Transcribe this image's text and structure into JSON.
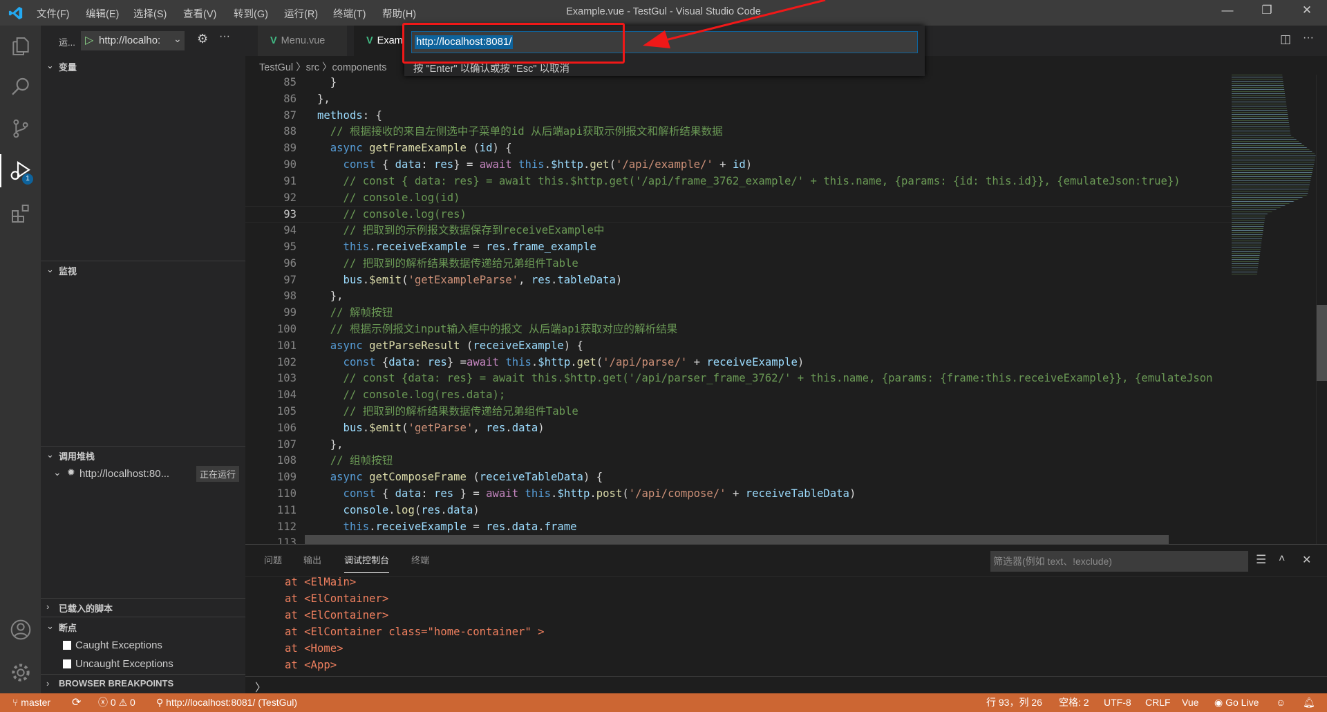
{
  "window": {
    "title": "Example.vue - TestGul - Visual Studio Code",
    "menu": [
      "文件(F)",
      "编辑(E)",
      "选择(S)",
      "查看(V)",
      "转到(G)",
      "运行(R)",
      "终端(T)",
      "帮助(H)"
    ],
    "controls": {
      "minimize": "—",
      "restore": "❐",
      "close": "✕"
    }
  },
  "sidebar": {
    "run_label": "运...",
    "config_select": "http://localho:",
    "sections": {
      "variables": "变量",
      "watch": "监视",
      "call_stack": "调用堆栈",
      "loaded_scripts": "已载入的脚本",
      "breakpoints": "断点",
      "browser_breakpoints": "BROWSER BREAKPOINTS"
    },
    "call_stack_item": {
      "name": "http://localhost:80...",
      "status": "正在运行"
    },
    "breakpoint_items": [
      {
        "label": "Caught Exceptions",
        "checked": false
      },
      {
        "label": "Uncaught Exceptions",
        "checked": false
      }
    ],
    "debug_badge": "1"
  },
  "tabs": [
    {
      "label": "Menu.vue",
      "active": false
    },
    {
      "label": "Exam",
      "active": true
    }
  ],
  "breadcrumb": "TestGul 〉src 〉components",
  "quick_input": {
    "value": "http://localhost:8081/",
    "hint": "按 \"Enter\" 以确认或按 \"Esc\" 以取消"
  },
  "editor": {
    "current_line": 93,
    "lines": [
      {
        "n": "85",
        "t": [
          [
            "  }",
            "p"
          ]
        ]
      },
      {
        "n": "86",
        "t": [
          [
            "},",
            "p"
          ]
        ]
      },
      {
        "n": "87",
        "t": [
          [
            "methods",
            "v"
          ],
          [
            ": {",
            "p"
          ]
        ]
      },
      {
        "n": "88",
        "t": [
          [
            "  // 根据接收的来自左侧选中子菜单的id 从后端api获取示例报文和解析结果数据",
            "c"
          ]
        ]
      },
      {
        "n": "89",
        "t": [
          [
            "  async ",
            "k"
          ],
          [
            "getFrameExample",
            "f"
          ],
          [
            " (",
            "p"
          ],
          [
            "id",
            "v"
          ],
          [
            ") {",
            "p"
          ]
        ]
      },
      {
        "n": "90",
        "t": [
          [
            "    const ",
            "k"
          ],
          [
            "{ ",
            "p"
          ],
          [
            "data",
            "v"
          ],
          [
            ": ",
            "p"
          ],
          [
            "res",
            "v"
          ],
          [
            "} = ",
            "p"
          ],
          [
            "await ",
            "a"
          ],
          [
            "this",
            "k"
          ],
          [
            ".",
            "p"
          ],
          [
            "$http",
            "v"
          ],
          [
            ".",
            "p"
          ],
          [
            "get",
            "f"
          ],
          [
            "(",
            "p"
          ],
          [
            "'/api/example/'",
            "s"
          ],
          [
            " + ",
            "p"
          ],
          [
            "id",
            "v"
          ],
          [
            ")",
            "p"
          ]
        ]
      },
      {
        "n": "91",
        "t": [
          [
            "    // const { data: res} = await this.$http.get('/api/frame_3762_example/' + this.name, {params: {id: this.id}}, {emulateJson:true})",
            "c"
          ]
        ]
      },
      {
        "n": "92",
        "t": [
          [
            "    // console.log(id)",
            "c"
          ]
        ]
      },
      {
        "n": "93",
        "t": [
          [
            "    // console.log(res)",
            "c"
          ]
        ]
      },
      {
        "n": "94",
        "t": [
          [
            "    // 把取到的示例报文数据保存到receiveExample中",
            "c"
          ]
        ]
      },
      {
        "n": "95",
        "t": [
          [
            "    this",
            "k"
          ],
          [
            ".",
            "p"
          ],
          [
            "receiveExample",
            "v"
          ],
          [
            " = ",
            "p"
          ],
          [
            "res",
            "v"
          ],
          [
            ".",
            "p"
          ],
          [
            "frame_example",
            "v"
          ]
        ]
      },
      {
        "n": "96",
        "t": [
          [
            "    // 把取到的解析结果数据传递给兄弟组件Table",
            "c"
          ]
        ]
      },
      {
        "n": "97",
        "t": [
          [
            "    bus",
            "v"
          ],
          [
            ".",
            "p"
          ],
          [
            "$emit",
            "f"
          ],
          [
            "(",
            "p"
          ],
          [
            "'getExampleParse'",
            "s"
          ],
          [
            ", ",
            "p"
          ],
          [
            "res",
            "v"
          ],
          [
            ".",
            "p"
          ],
          [
            "tableData",
            "v"
          ],
          [
            ")",
            "p"
          ]
        ]
      },
      {
        "n": "98",
        "t": [
          [
            "  },",
            "p"
          ]
        ]
      },
      {
        "n": "99",
        "t": [
          [
            "  // 解帧按钮",
            "c"
          ]
        ]
      },
      {
        "n": "100",
        "t": [
          [
            "  // 根据示例报文input输入框中的报文 从后端api获取对应的解析结果",
            "c"
          ]
        ]
      },
      {
        "n": "101",
        "t": [
          [
            "  async ",
            "k"
          ],
          [
            "getParseResult",
            "f"
          ],
          [
            " (",
            "p"
          ],
          [
            "receiveExample",
            "v"
          ],
          [
            ") {",
            "p"
          ]
        ]
      },
      {
        "n": "102",
        "t": [
          [
            "    const ",
            "k"
          ],
          [
            "{",
            "p"
          ],
          [
            "data",
            "v"
          ],
          [
            ": ",
            "p"
          ],
          [
            "res",
            "v"
          ],
          [
            "} =",
            "p"
          ],
          [
            "await ",
            "a"
          ],
          [
            "this",
            "k"
          ],
          [
            ".",
            "p"
          ],
          [
            "$http",
            "v"
          ],
          [
            ".",
            "p"
          ],
          [
            "get",
            "f"
          ],
          [
            "(",
            "p"
          ],
          [
            "'/api/parse/'",
            "s"
          ],
          [
            " + ",
            "p"
          ],
          [
            "receiveExample",
            "v"
          ],
          [
            ")",
            "p"
          ]
        ]
      },
      {
        "n": "103",
        "t": [
          [
            "    // const {data: res} = await this.$http.get('/api/parser_frame_3762/' + this.name, {params: {frame:this.receiveExample}}, {emulateJson",
            "c"
          ]
        ]
      },
      {
        "n": "104",
        "t": [
          [
            "    // console.log(res.data);",
            "c"
          ]
        ]
      },
      {
        "n": "105",
        "t": [
          [
            "    // 把取到的解析结果数据传递给兄弟组件Table",
            "c"
          ]
        ]
      },
      {
        "n": "106",
        "t": [
          [
            "    bus",
            "v"
          ],
          [
            ".",
            "p"
          ],
          [
            "$emit",
            "f"
          ],
          [
            "(",
            "p"
          ],
          [
            "'getParse'",
            "s"
          ],
          [
            ", ",
            "p"
          ],
          [
            "res",
            "v"
          ],
          [
            ".",
            "p"
          ],
          [
            "data",
            "v"
          ],
          [
            ")",
            "p"
          ]
        ]
      },
      {
        "n": "107",
        "t": [
          [
            "  },",
            "p"
          ]
        ]
      },
      {
        "n": "108",
        "t": [
          [
            "  // 组帧按钮",
            "c"
          ]
        ]
      },
      {
        "n": "109",
        "t": [
          [
            "  async ",
            "k"
          ],
          [
            "getComposeFrame",
            "f"
          ],
          [
            " (",
            "p"
          ],
          [
            "receiveTableData",
            "v"
          ],
          [
            ") {",
            "p"
          ]
        ]
      },
      {
        "n": "110",
        "t": [
          [
            "    const ",
            "k"
          ],
          [
            "{ ",
            "p"
          ],
          [
            "data",
            "v"
          ],
          [
            ": ",
            "p"
          ],
          [
            "res",
            "v"
          ],
          [
            " } = ",
            "p"
          ],
          [
            "await ",
            "a"
          ],
          [
            "this",
            "k"
          ],
          [
            ".",
            "p"
          ],
          [
            "$http",
            "v"
          ],
          [
            ".",
            "p"
          ],
          [
            "post",
            "f"
          ],
          [
            "(",
            "p"
          ],
          [
            "'/api/compose/'",
            "s"
          ],
          [
            " + ",
            "p"
          ],
          [
            "receiveTableData",
            "v"
          ],
          [
            ")",
            "p"
          ]
        ]
      },
      {
        "n": "111",
        "t": [
          [
            "    console",
            "v"
          ],
          [
            ".",
            "p"
          ],
          [
            "log",
            "f"
          ],
          [
            "(",
            "p"
          ],
          [
            "res",
            "v"
          ],
          [
            ".",
            "p"
          ],
          [
            "data",
            "v"
          ],
          [
            ")",
            "p"
          ]
        ]
      },
      {
        "n": "112",
        "t": [
          [
            "    this",
            "k"
          ],
          [
            ".",
            "p"
          ],
          [
            "receiveExample",
            "v"
          ],
          [
            " = ",
            "p"
          ],
          [
            "res",
            "v"
          ],
          [
            ".",
            "p"
          ],
          [
            "data",
            "v"
          ],
          [
            ".",
            "p"
          ],
          [
            "frame",
            "v"
          ]
        ]
      },
      {
        "n": "113",
        "t": [
          [
            "  }",
            "p"
          ]
        ]
      }
    ]
  },
  "panel": {
    "tabs": [
      "问题",
      "输出",
      "调试控制台",
      "终端"
    ],
    "active_tab": "调试控制台",
    "filter_placeholder": "筛选器(例如 text、!exclude)",
    "console_lines": [
      "at <ElMain>",
      "at <ElContainer>",
      "at <ElContainer>",
      "at <ElContainer class=\"home-container\" >",
      "at <Home>",
      "at <App>"
    ],
    "prompt": "〉"
  },
  "statusbar": {
    "branch": "master",
    "errors": "0",
    "warnings": "0",
    "debug_target": "http://localhost:8081/ (TestGul)",
    "position": "行 93，列 26",
    "spaces": "空格: 2",
    "encoding": "UTF-8",
    "eol": "CRLF",
    "language": "Vue",
    "go_live": "Go Live",
    "color": "#cc6633"
  },
  "colors": {
    "annotation": "#f01818",
    "accent": "#0e639c"
  }
}
